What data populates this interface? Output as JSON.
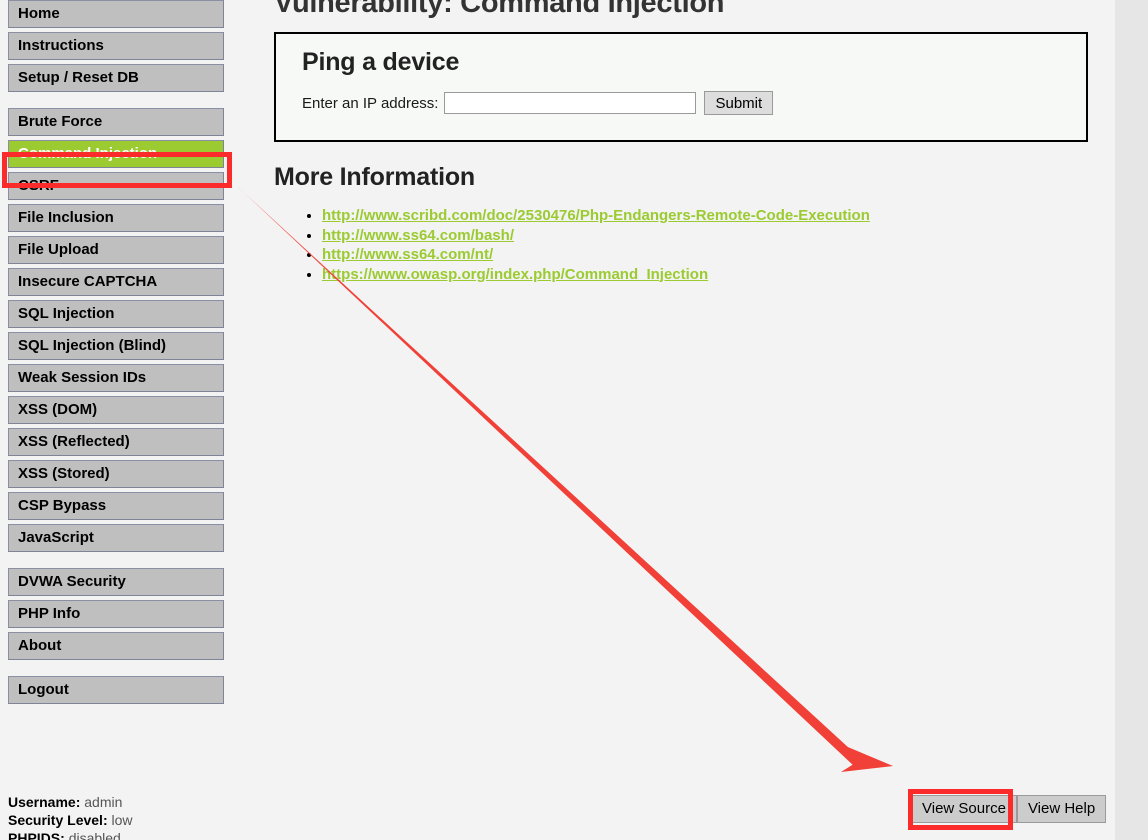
{
  "sidebar": {
    "groups": [
      {
        "name": "primary",
        "items": [
          {
            "label": "Home",
            "selected": false
          },
          {
            "label": "Instructions",
            "selected": false
          },
          {
            "label": "Setup / Reset DB",
            "selected": false
          }
        ]
      },
      {
        "name": "vulnerabilities",
        "items": [
          {
            "label": "Brute Force",
            "selected": false
          },
          {
            "label": "Command Injection",
            "selected": true
          },
          {
            "label": "CSRF",
            "selected": false
          },
          {
            "label": "File Inclusion",
            "selected": false
          },
          {
            "label": "File Upload",
            "selected": false
          },
          {
            "label": "Insecure CAPTCHA",
            "selected": false
          },
          {
            "label": "SQL Injection",
            "selected": false
          },
          {
            "label": "SQL Injection (Blind)",
            "selected": false
          },
          {
            "label": "Weak Session IDs",
            "selected": false
          },
          {
            "label": "XSS (DOM)",
            "selected": false
          },
          {
            "label": "XSS (Reflected)",
            "selected": false
          },
          {
            "label": "XSS (Stored)",
            "selected": false
          },
          {
            "label": "CSP Bypass",
            "selected": false
          },
          {
            "label": "JavaScript",
            "selected": false
          }
        ]
      },
      {
        "name": "meta",
        "items": [
          {
            "label": "DVWA Security",
            "selected": false
          },
          {
            "label": "PHP Info",
            "selected": false
          },
          {
            "label": "About",
            "selected": false
          }
        ]
      },
      {
        "name": "session",
        "items": [
          {
            "label": "Logout",
            "selected": false
          }
        ]
      }
    ],
    "status": [
      {
        "label": "Username:",
        "value": "admin"
      },
      {
        "label": "Security Level:",
        "value": "low"
      },
      {
        "label": "PHPIDS:",
        "value": "disabled"
      }
    ]
  },
  "main": {
    "page_title": "Vulnerability: Command Injection",
    "panel": {
      "heading": "Ping a device",
      "ip_label": "Enter an IP address:",
      "ip_value": "",
      "ip_placeholder": "",
      "submit_label": "Submit"
    },
    "more_info": {
      "heading": "More Information",
      "links": [
        "http://www.scribd.com/doc/2530476/Php-Endangers-Remote-Code-Execution",
        "http://www.ss64.com/bash/",
        "http://www.ss64.com/nt/",
        "https://www.owasp.org/index.php/Command_Injection"
      ]
    },
    "footer_buttons": {
      "view_source_label": "View Source",
      "view_help_label": "View Help"
    }
  },
  "annotations": {
    "arrow_color": "#F04037",
    "highlight_color": "#FB2B2B",
    "arrow_from": "Command Injection",
    "arrow_to": "View Source"
  },
  "colors": {
    "accent_green": "#9BCB31",
    "nav_gray": "#BFBFBF",
    "page_background": "#F3F3F3",
    "scrollbar_track": "#E6E6E6"
  }
}
